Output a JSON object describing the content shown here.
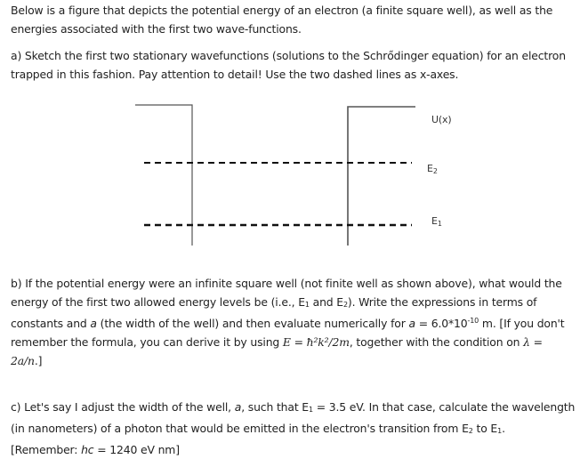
{
  "intro": {
    "line1": "Below is a figure that depicts the potential energy of an electron (a finite square well), as well as the",
    "line2": "energies associated with the first two wave-functions."
  },
  "part_a": {
    "line1": "a) Sketch the first two stationary wavefunctions (solutions to the Schrődinger equation) for an electron",
    "line2": "trapped in this fashion. Pay attention to detail! Use the two dashed lines as x-axes."
  },
  "figure": {
    "potential_label": "U(x)",
    "level2_label": "E",
    "level2_sub": "2",
    "level1_label": "E",
    "level1_sub": "1"
  },
  "part_b": {
    "line1": "b) If the potential energy were an infinite square well (not finite well as shown above), what would the",
    "line2a": "energy of the first two allowed energy levels be (i.e., E",
    "line2b": " and E",
    "line2c": "). Write the expressions in terms of",
    "line3a": "constants and ",
    "var_a": "a",
    "line3b": " (the width of the well) and then evaluate numerically for ",
    "line3c": " = 6.0*10",
    "exp": "-10",
    "line3d": " m.  [If you don't",
    "line4a": "remember the formula, you can derive it by using ",
    "formula": "E = ħ²k²/2m",
    "line4b": ", together with the condition on ",
    "lambda": "λ =",
    "line5": "2a/n",
    "line5b": ".]",
    "sub1": "1",
    "sub2": "2"
  },
  "part_c": {
    "line1a": "c) Let's say I adjust the width of the well, ",
    "var_a": "a",
    "line1b": ", such that E",
    "sub1": "1",
    "line1c": " = 3.5 eV. In that case, calculate the wavelength",
    "line2a": "(in nanometers) of a photon that would be emitted in the electron's transition from E",
    "sub2": "2",
    "line2b": " to E",
    "line2c": ".",
    "line3a": "[Remember: ",
    "hc": "hc",
    "line3b": " = 1240 eV nm]"
  }
}
